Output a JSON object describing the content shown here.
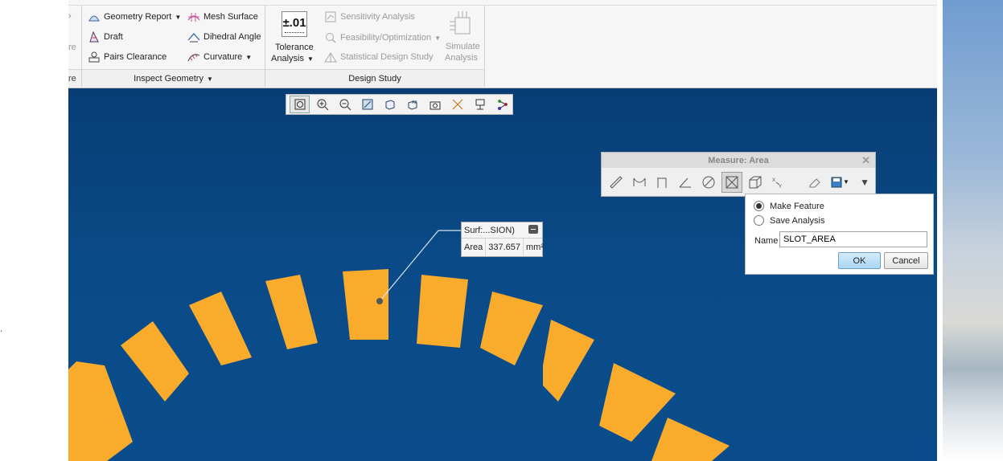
{
  "ribbon": {
    "cut_left_labels": {
      "top": "re",
      "bottom": "re"
    },
    "inspect_items": [
      {
        "label": "Geometry Report",
        "has_dropdown": true
      },
      {
        "label": "Draft",
        "has_dropdown": false
      },
      {
        "label": "Pairs Clearance",
        "has_dropdown": false
      },
      {
        "label": "Mesh Surface",
        "has_dropdown": false
      },
      {
        "label": "Dihedral Angle",
        "has_dropdown": false
      },
      {
        "label": "Curvature",
        "has_dropdown": true
      }
    ],
    "tolerance": {
      "icon_text": "±.01",
      "label_line1": "Tolerance",
      "label_line2": "Analysis"
    },
    "design_items": [
      {
        "label": "Sensitivity Analysis",
        "disabled": true
      },
      {
        "label": "Feasibility/Optimization",
        "disabled": true
      },
      {
        "label": "Statistical Design Study",
        "disabled": true
      }
    ],
    "simulate": {
      "label_line1": "Simulate",
      "label_line2": "Analysis"
    },
    "groups": {
      "inspect": "Inspect Geometry",
      "design": "Design Study"
    }
  },
  "callout": {
    "surface": "Surf:...SION)",
    "measure": "Area",
    "value": "337.657",
    "unit": "mm²"
  },
  "measure_dialog": {
    "title": "Measure: Area"
  },
  "save_popup": {
    "option_make": "Make Feature",
    "option_save": "Save Analysis",
    "name_label": "Name",
    "name_value": "SLOT_AREA",
    "ok": "OK",
    "cancel": "Cancel",
    "selected": "make"
  },
  "colors": {
    "viewport": "#0a4a87",
    "part": "#f9ab2c",
    "ok_button": "#a9d5f3"
  }
}
